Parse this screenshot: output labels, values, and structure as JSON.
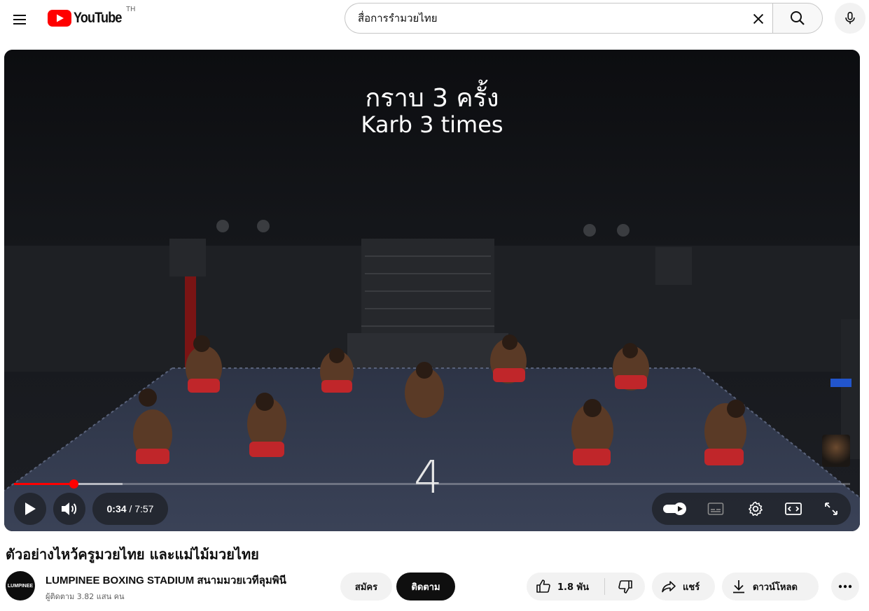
{
  "header": {
    "logo_text": "YouTube",
    "country_code": "TH",
    "search_value": "สื่อการรำมวยไทย",
    "icons": {
      "menu": "hamburger-menu-icon",
      "clear": "close-icon",
      "search": "search-icon",
      "mic": "microphone-icon"
    }
  },
  "player": {
    "caption_line1": "กราบ 3 ครั้ง",
    "caption_line2": "Karb 3 times",
    "count_overlay": "4",
    "current_time": "0:34",
    "duration": "/ 7:57",
    "progress_played_fraction": 0.0712,
    "progress_buffered_fraction": 0.13,
    "colors": {
      "progress": "#ff0000"
    }
  },
  "video": {
    "title": "ตัวอย่างไหว้ครูมวยไทย และแม่ไม้มวยไทย"
  },
  "channel": {
    "avatar_text": "LUMPINEE",
    "name": "LUMPINEE BOXING STADIUM สนามมวยเวทีลุมพินี",
    "subscribers": "ผู้ติดตาม 3.82 แสน คน",
    "join_label": "สมัคร",
    "subscribe_label": "ติดตาม"
  },
  "actions": {
    "like_count": "1.8 พัน",
    "share_label": "แชร์",
    "download_label": "ดาวน์โหลด"
  }
}
